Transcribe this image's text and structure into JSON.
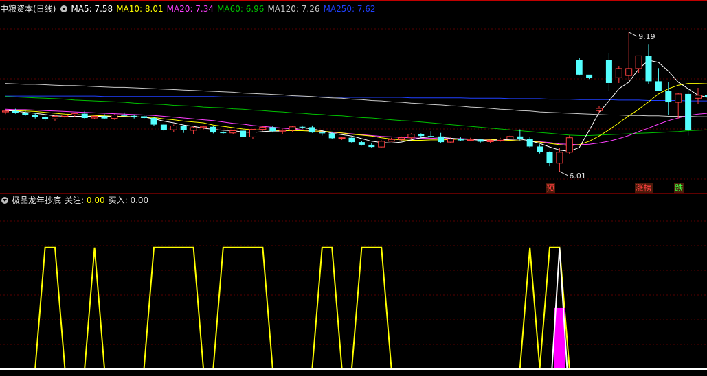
{
  "window": {
    "stock_name": "中粮资本",
    "period_label": "(日线)",
    "indicator_name": "极品龙年抄底"
  },
  "colors": {
    "background": "#000000",
    "grid": "#5a0000",
    "divider": "#c00000",
    "up": "#ff4040",
    "down": "#54ffff",
    "ma5": "#ffffff",
    "ma10": "#ffff00",
    "ma20": "#ff40ff",
    "ma60": "#00c000",
    "ma120": "#c8c8c8",
    "ma250": "#2040ff",
    "signal_line": "#ffff00",
    "buy_bar": "#ff00ff",
    "white_line": "#ffffff"
  },
  "legend": [
    {
      "key": "ma5",
      "label": "MA5:",
      "value": "7.58"
    },
    {
      "key": "ma10",
      "label": "MA10:",
      "value": "8.01"
    },
    {
      "key": "ma20",
      "label": "MA20:",
      "value": "7.34"
    },
    {
      "key": "ma60",
      "label": "MA60:",
      "value": "6.96"
    },
    {
      "key": "ma120",
      "label": "MA120:",
      "value": "7.26"
    },
    {
      "key": "ma250",
      "label": "MA250:",
      "value": "7.62"
    }
  ],
  "indicator_legend": [
    {
      "label": "关注:",
      "value": "0.00"
    },
    {
      "label": "买入:",
      "value": "0.00"
    }
  ],
  "chart_data": [
    {
      "type": "candlestick",
      "title": "中粮资本 (日线)",
      "ylim": [
        5.6,
        9.55
      ],
      "candles": [
        [
          7.37,
          7.42,
          7.32,
          7.39
        ],
        [
          7.39,
          7.44,
          7.33,
          7.35
        ],
        [
          7.35,
          7.41,
          7.28,
          7.3
        ],
        [
          7.3,
          7.34,
          7.22,
          7.26
        ],
        [
          7.26,
          7.29,
          7.16,
          7.21
        ],
        [
          7.21,
          7.29,
          7.17,
          7.27
        ],
        [
          7.27,
          7.34,
          7.22,
          7.3
        ],
        [
          7.3,
          7.35,
          7.26,
          7.33
        ],
        [
          7.33,
          7.39,
          7.2,
          7.23
        ],
        [
          7.23,
          7.29,
          7.2,
          7.27
        ],
        [
          7.27,
          7.32,
          7.21,
          7.22
        ],
        [
          7.22,
          7.32,
          7.19,
          7.3
        ],
        [
          7.3,
          7.36,
          7.26,
          7.28
        ],
        [
          7.28,
          7.31,
          7.22,
          7.27
        ],
        [
          7.27,
          7.31,
          7.21,
          7.23
        ],
        [
          7.23,
          7.26,
          7.05,
          7.08
        ],
        [
          7.08,
          7.11,
          6.93,
          6.96
        ],
        [
          6.96,
          7.08,
          6.91,
          7.05
        ],
        [
          7.05,
          7.08,
          6.89,
          6.95
        ],
        [
          6.95,
          7.04,
          6.86,
          7.01
        ],
        [
          7.01,
          7.06,
          6.97,
          7.03
        ],
        [
          7.03,
          7.05,
          6.88,
          6.9
        ],
        [
          6.9,
          6.93,
          6.86,
          6.89
        ],
        [
          6.89,
          6.96,
          6.87,
          6.94
        ],
        [
          6.94,
          6.97,
          6.79,
          6.8
        ],
        [
          6.8,
          6.98,
          6.76,
          6.97
        ],
        [
          6.97,
          7.04,
          6.94,
          7.02
        ],
        [
          7.02,
          7.04,
          6.9,
          6.93
        ],
        [
          6.93,
          6.97,
          6.87,
          6.95
        ],
        [
          6.95,
          7.05,
          6.92,
          7.03
        ],
        [
          7.03,
          7.06,
          6.98,
          7.02
        ],
        [
          7.02,
          7.06,
          6.89,
          6.9
        ],
        [
          6.9,
          6.93,
          6.83,
          6.88
        ],
        [
          6.88,
          6.91,
          6.75,
          6.77
        ],
        [
          6.77,
          6.79,
          6.73,
          6.78
        ],
        [
          6.78,
          6.79,
          6.66,
          6.68
        ],
        [
          6.68,
          6.71,
          6.6,
          6.62
        ],
        [
          6.62,
          6.65,
          6.55,
          6.57
        ],
        [
          6.57,
          6.72,
          6.56,
          6.7
        ],
        [
          6.7,
          6.78,
          6.69,
          6.74
        ],
        [
          6.74,
          6.81,
          6.7,
          6.78
        ],
        [
          6.78,
          6.88,
          6.74,
          6.86
        ],
        [
          6.86,
          6.88,
          6.78,
          6.82
        ],
        [
          6.82,
          6.93,
          6.8,
          6.81
        ],
        [
          6.81,
          6.89,
          6.66,
          6.68
        ],
        [
          6.68,
          6.79,
          6.65,
          6.75
        ],
        [
          6.75,
          6.79,
          6.7,
          6.72
        ],
        [
          6.72,
          6.78,
          6.7,
          6.74
        ],
        [
          6.74,
          6.76,
          6.67,
          6.69
        ],
        [
          6.69,
          6.74,
          6.66,
          6.72
        ],
        [
          6.72,
          6.78,
          6.69,
          6.75
        ],
        [
          6.75,
          6.84,
          6.71,
          6.81
        ],
        [
          6.81,
          6.97,
          6.72,
          6.75
        ],
        [
          6.75,
          6.8,
          6.54,
          6.58
        ],
        [
          6.58,
          6.63,
          6.42,
          6.45
        ],
        [
          6.45,
          6.47,
          6.13,
          6.2
        ],
        [
          6.2,
          6.55,
          6.01,
          6.45
        ],
        [
          6.45,
          6.83,
          6.4,
          6.78
        ],
        [
          8.55,
          8.6,
          8.2,
          8.22
        ],
        [
          8.22,
          8.2,
          8.12,
          8.15
        ],
        [
          7.4,
          7.5,
          7.35,
          7.45
        ],
        [
          8.55,
          8.72,
          7.85,
          8.03
        ],
        [
          8.15,
          8.42,
          8.03,
          8.36
        ],
        [
          8.2,
          9.19,
          8.1,
          8.36
        ],
        [
          8.36,
          8.65,
          8.25,
          8.65
        ],
        [
          8.65,
          8.92,
          8.0,
          8.07
        ],
        [
          8.07,
          8.37,
          7.85,
          7.85
        ],
        [
          7.85,
          8.05,
          7.3,
          7.59
        ],
        [
          7.59,
          7.81,
          7.22,
          7.78
        ],
        [
          7.78,
          7.9,
          6.83,
          6.95
        ],
        [
          7.68,
          7.92,
          7.55,
          7.75
        ],
        [
          7.75,
          7.88,
          7.55,
          7.7
        ]
      ],
      "series": [
        {
          "name": "MA5",
          "values": [
            7.4,
            7.39,
            7.36,
            7.34,
            7.31,
            7.28,
            7.27,
            7.27,
            7.27,
            7.27,
            7.27,
            7.26,
            7.26,
            7.26,
            7.25,
            7.21,
            7.16,
            7.12,
            7.07,
            7.04,
            7.0,
            6.97,
            6.95,
            6.94,
            6.91,
            6.9,
            6.92,
            6.93,
            6.93,
            6.98,
            7.01,
            6.98,
            6.94,
            6.88,
            6.85,
            6.82,
            6.76,
            6.7,
            6.67,
            6.66,
            6.68,
            6.73,
            6.78,
            6.8,
            6.79,
            6.77,
            6.75,
            6.74,
            6.72,
            6.72,
            6.73,
            6.74,
            6.75,
            6.71,
            6.65,
            6.57,
            6.5,
            6.47,
            6.56,
            6.95,
            7.36,
            7.62,
            7.9,
            8.05,
            8.35,
            8.55,
            8.5,
            8.3,
            8.05,
            7.9,
            7.75,
            7.7
          ]
        },
        {
          "name": "MA10",
          "values": [
            7.41,
            7.4,
            7.39,
            7.38,
            7.36,
            7.34,
            7.32,
            7.31,
            7.3,
            7.29,
            7.28,
            7.27,
            7.27,
            7.26,
            7.25,
            7.24,
            7.21,
            7.19,
            7.16,
            7.14,
            7.12,
            7.07,
            7.04,
            7.01,
            6.98,
            6.96,
            6.96,
            6.95,
            6.94,
            6.94,
            6.94,
            6.93,
            6.93,
            6.91,
            6.89,
            6.86,
            6.84,
            6.82,
            6.78,
            6.75,
            6.73,
            6.72,
            6.72,
            6.73,
            6.73,
            6.74,
            6.75,
            6.75,
            6.75,
            6.74,
            6.73,
            6.72,
            6.71,
            6.7,
            6.68,
            6.65,
            6.62,
            6.6,
            6.62,
            6.7,
            6.82,
            6.96,
            7.12,
            7.28,
            7.43,
            7.6,
            7.78,
            7.9,
            7.98,
            8.02,
            8.02,
            8.01
          ]
        },
        {
          "name": "MA20",
          "values": [
            7.43,
            7.42,
            7.42,
            7.41,
            7.4,
            7.39,
            7.38,
            7.37,
            7.36,
            7.35,
            7.34,
            7.33,
            7.32,
            7.31,
            7.3,
            7.29,
            7.27,
            7.25,
            7.23,
            7.21,
            7.19,
            7.17,
            7.14,
            7.11,
            7.09,
            7.06,
            7.04,
            7.02,
            7.0,
            6.98,
            6.96,
            6.94,
            6.92,
            6.9,
            6.89,
            6.87,
            6.85,
            6.83,
            6.81,
            6.8,
            6.79,
            6.78,
            6.77,
            6.77,
            6.76,
            6.76,
            6.76,
            6.75,
            6.74,
            6.74,
            6.73,
            6.72,
            6.71,
            6.7,
            6.69,
            6.67,
            6.64,
            6.63,
            6.62,
            6.63,
            6.66,
            6.7,
            6.76,
            6.83,
            6.92,
            7.0,
            7.09,
            7.17,
            7.23,
            7.29,
            7.32,
            7.34
          ]
        },
        {
          "name": "MA60",
          "values": [
            7.72,
            7.71,
            7.7,
            7.69,
            7.68,
            7.67,
            7.66,
            7.64,
            7.63,
            7.62,
            7.61,
            7.6,
            7.59,
            7.57,
            7.56,
            7.55,
            7.54,
            7.52,
            7.51,
            7.5,
            7.48,
            7.47,
            7.46,
            7.44,
            7.43,
            7.41,
            7.4,
            7.38,
            7.37,
            7.35,
            7.34,
            7.32,
            7.31,
            7.29,
            7.28,
            7.26,
            7.24,
            7.23,
            7.21,
            7.19,
            7.17,
            7.16,
            7.14,
            7.12,
            7.1,
            7.08,
            7.06,
            7.04,
            7.02,
            7.0,
            6.98,
            6.96,
            6.94,
            6.92,
            6.9,
            6.88,
            6.86,
            6.84,
            6.83,
            6.83,
            6.84,
            6.85,
            6.86,
            6.87,
            6.88,
            6.89,
            6.9,
            6.91,
            6.92,
            6.94,
            6.95,
            6.96
          ]
        },
        {
          "name": "MA120",
          "values": [
            8.02,
            8.01,
            8.0,
            8.0,
            7.99,
            7.98,
            7.97,
            7.97,
            7.96,
            7.95,
            7.94,
            7.93,
            7.93,
            7.92,
            7.91,
            7.9,
            7.89,
            7.88,
            7.87,
            7.86,
            7.85,
            7.84,
            7.83,
            7.82,
            7.8,
            7.79,
            7.78,
            7.77,
            7.76,
            7.74,
            7.73,
            7.72,
            7.7,
            7.69,
            7.68,
            7.66,
            7.65,
            7.63,
            7.62,
            7.6,
            7.59,
            7.57,
            7.56,
            7.54,
            7.53,
            7.51,
            7.5,
            7.48,
            7.47,
            7.45,
            7.43,
            7.42,
            7.4,
            7.39,
            7.37,
            7.36,
            7.35,
            7.34,
            7.33,
            7.32,
            7.31,
            7.3,
            7.3,
            7.29,
            7.29,
            7.28,
            7.28,
            7.27,
            7.27,
            7.27,
            7.26,
            7.26
          ]
        },
        {
          "name": "MA250",
          "values": [
            7.73,
            7.73,
            7.73,
            7.73,
            7.73,
            7.73,
            7.73,
            7.73,
            7.73,
            7.73,
            7.72,
            7.72,
            7.72,
            7.72,
            7.72,
            7.72,
            7.72,
            7.72,
            7.72,
            7.72,
            7.72,
            7.72,
            7.71,
            7.71,
            7.71,
            7.71,
            7.71,
            7.71,
            7.71,
            7.71,
            7.71,
            7.71,
            7.71,
            7.71,
            7.7,
            7.7,
            7.7,
            7.7,
            7.7,
            7.7,
            7.7,
            7.69,
            7.69,
            7.69,
            7.69,
            7.69,
            7.69,
            7.68,
            7.68,
            7.68,
            7.68,
            7.67,
            7.67,
            7.67,
            7.67,
            7.66,
            7.66,
            7.66,
            7.65,
            7.65,
            7.65,
            7.65,
            7.64,
            7.64,
            7.64,
            7.63,
            7.63,
            7.63,
            7.63,
            7.62,
            7.62,
            7.62
          ]
        }
      ],
      "annotations": [
        {
          "text": "9.19",
          "index": 63,
          "value": 9.19,
          "kind": "high"
        },
        {
          "text": "6.01",
          "index": 56,
          "value": 6.01,
          "kind": "low"
        }
      ],
      "tags": [
        {
          "text": "预",
          "index": 55,
          "color": "#ff4040",
          "bg": "#4a1a0a"
        },
        {
          "text": "涨榜",
          "index": 64,
          "color": "#ff4040",
          "bg": "#4a1a0a"
        },
        {
          "text": "跌",
          "index": 68,
          "color": "#40ff40",
          "bg": "#4a1a0a"
        }
      ]
    },
    {
      "type": "line",
      "title": "极品龙年抄底",
      "ylim": [
        0,
        1.05
      ],
      "series": [
        {
          "name": "关注",
          "values": [
            0,
            0,
            0,
            0,
            1,
            1,
            0,
            0,
            0,
            1,
            0,
            0,
            0,
            0,
            0,
            1,
            1,
            1,
            1,
            1,
            0,
            0,
            1,
            1,
            1,
            1,
            1,
            0,
            0,
            0,
            0,
            0,
            1,
            1,
            0,
            0,
            1,
            1,
            1,
            0,
            0,
            0,
            0,
            0,
            0,
            0,
            0,
            0,
            0,
            0,
            0,
            0,
            0,
            1,
            0,
            1,
            1,
            0,
            0,
            0,
            0,
            0,
            0,
            0,
            0,
            0,
            0,
            0,
            0,
            0,
            0,
            0
          ]
        },
        {
          "name": "买入",
          "values": [
            0,
            0,
            0,
            0,
            0,
            0,
            0,
            0,
            0,
            0,
            0,
            0,
            0,
            0,
            0,
            0,
            0,
            0,
            0,
            0,
            0,
            0,
            0,
            0,
            0,
            0,
            0,
            0,
            0,
            0,
            0,
            0,
            0,
            0,
            0,
            0,
            0,
            0,
            0,
            0,
            0,
            0,
            0,
            0,
            0,
            0,
            0,
            0,
            0,
            0,
            0,
            0,
            0,
            0,
            0,
            0,
            0.5,
            0,
            0,
            0,
            0,
            0,
            0,
            0,
            0,
            0,
            0,
            0,
            0,
            0,
            0,
            0
          ]
        }
      ]
    }
  ]
}
